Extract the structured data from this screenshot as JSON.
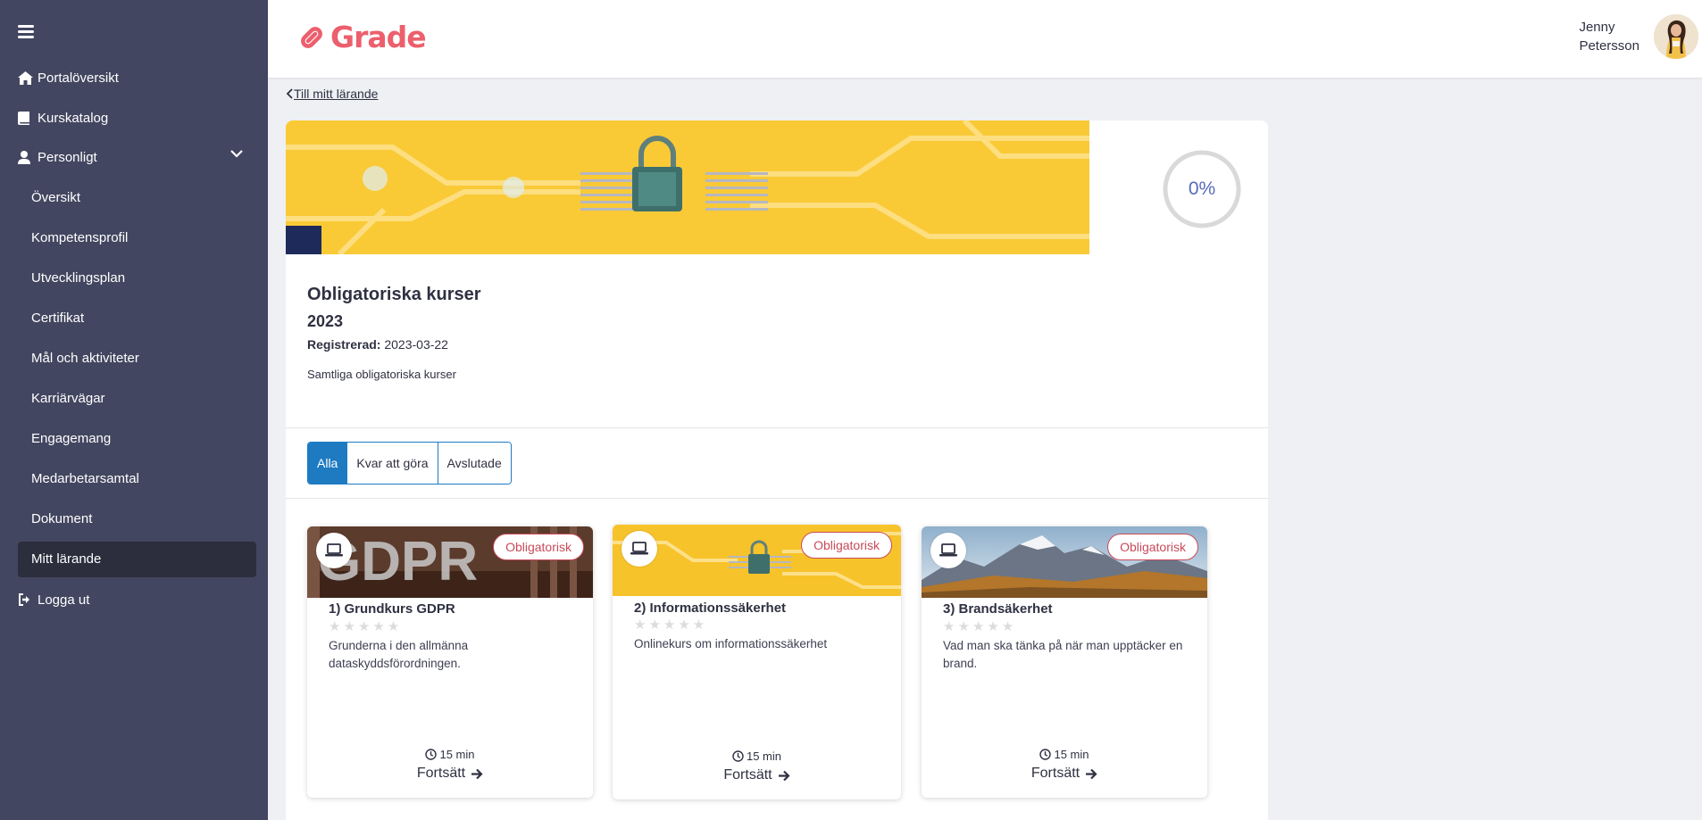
{
  "sidebar": {
    "nav": [
      {
        "label": "Portalöversikt",
        "icon": "home-icon"
      },
      {
        "label": "Kurskatalog",
        "icon": "book-icon"
      },
      {
        "label": "Personligt",
        "icon": "user-icon"
      }
    ],
    "sub_items": [
      {
        "label": "Översikt"
      },
      {
        "label": "Kompetensprofil"
      },
      {
        "label": "Utvecklingsplan"
      },
      {
        "label": "Certifikat"
      },
      {
        "label": "Mål och aktiviteter"
      },
      {
        "label": "Karriärvägar"
      },
      {
        "label": "Engagemang"
      },
      {
        "label": "Medarbetarsamtal"
      },
      {
        "label": "Dokument"
      },
      {
        "label": "Mitt lärande"
      }
    ],
    "active_item": "Mitt lärande",
    "logout_label": "Logga ut"
  },
  "header": {
    "logo_text": "Grade",
    "user_first": "Jenny",
    "user_last": "Petersson"
  },
  "back_link": "Till mitt lärande",
  "program": {
    "progress_label": "0%",
    "progress_value": 0,
    "title": "Obligatoriska kurser",
    "year": "2023",
    "registered_label": "Registrerad:",
    "registered_date": "2023-03-22",
    "description": "Samtliga obligatoriska kurser"
  },
  "filters": [
    {
      "label": "Alla",
      "active": true
    },
    {
      "label": "Kvar att göra",
      "active": false
    },
    {
      "label": "Avslutade",
      "active": false
    }
  ],
  "courses": [
    {
      "badge": "Obligatorisk",
      "title": "1) Grundkurs GDPR",
      "stars": "★★★★★",
      "description": "Grunderna i den allmänna dataskyddsförordningen.",
      "duration": "15 min",
      "cta": "Fortsätt",
      "image_text": "GDPR"
    },
    {
      "badge": "Obligatorisk",
      "title": "2) Informationssäkerhet",
      "stars": "★★★★★",
      "description": "Onlinekurs om informationssäkerhet",
      "duration": "15 min",
      "cta": "Fortsätt"
    },
    {
      "badge": "Obligatorisk",
      "title": "3) Brandsäkerhet",
      "stars": "★★★★★",
      "description": "Vad man ska tänka på när man upptäcker en brand.",
      "duration": "15 min",
      "cta": "Fortsätt"
    }
  ],
  "colors": {
    "sidebar_bg": "#424660",
    "brand": "#ec5f6d",
    "accent_blue": "#1e7bc2",
    "badge_red": "#c84a5a"
  }
}
